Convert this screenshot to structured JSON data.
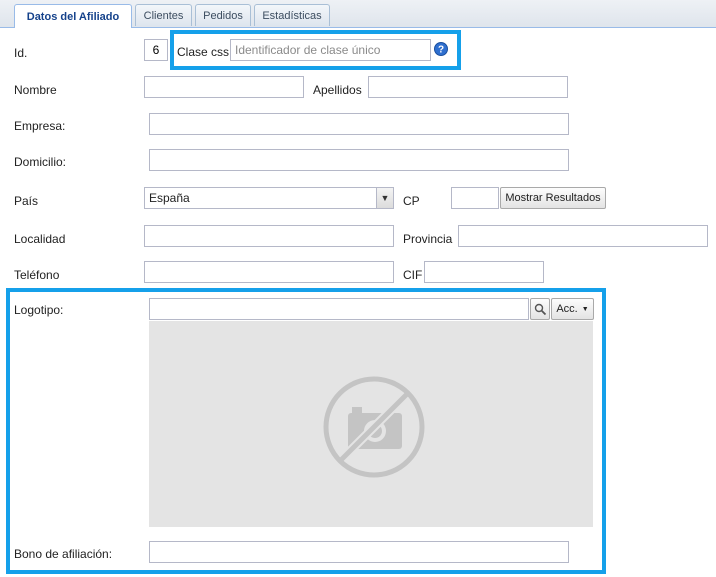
{
  "tabs": [
    {
      "label": "Datos del Afiliado",
      "active": true
    },
    {
      "label": "Clientes"
    },
    {
      "label": "Pedidos"
    },
    {
      "label": "Estadísticas"
    }
  ],
  "form": {
    "id_label": "Id.",
    "id_value": "6",
    "css_class_label": "Clase css",
    "css_class_placeholder": "Identificador de clase único",
    "nombre_label": "Nombre",
    "apellidos_label": "Apellidos",
    "empresa_label": "Empresa:",
    "domicilio_label": "Domicilio:",
    "pais_label": "País",
    "pais_value": "España",
    "cp_label": "CP",
    "mostrar_button": "Mostrar Resultados",
    "localidad_label": "Localidad",
    "provincia_label": "Provincia",
    "telefono_label": "Teléfono",
    "cif_label": "CIF",
    "logotipo_label": "Logotipo:",
    "acc_button": "Acc.",
    "bono_label": "Bono de afiliación:"
  },
  "colors": {
    "highlight": "#15a0ea",
    "tab_active_text": "#15428b",
    "help_icon": "#2f6fcf"
  },
  "icons": {
    "help": "question-mark",
    "search": "magnifier",
    "no_image": "camera-crossed"
  }
}
